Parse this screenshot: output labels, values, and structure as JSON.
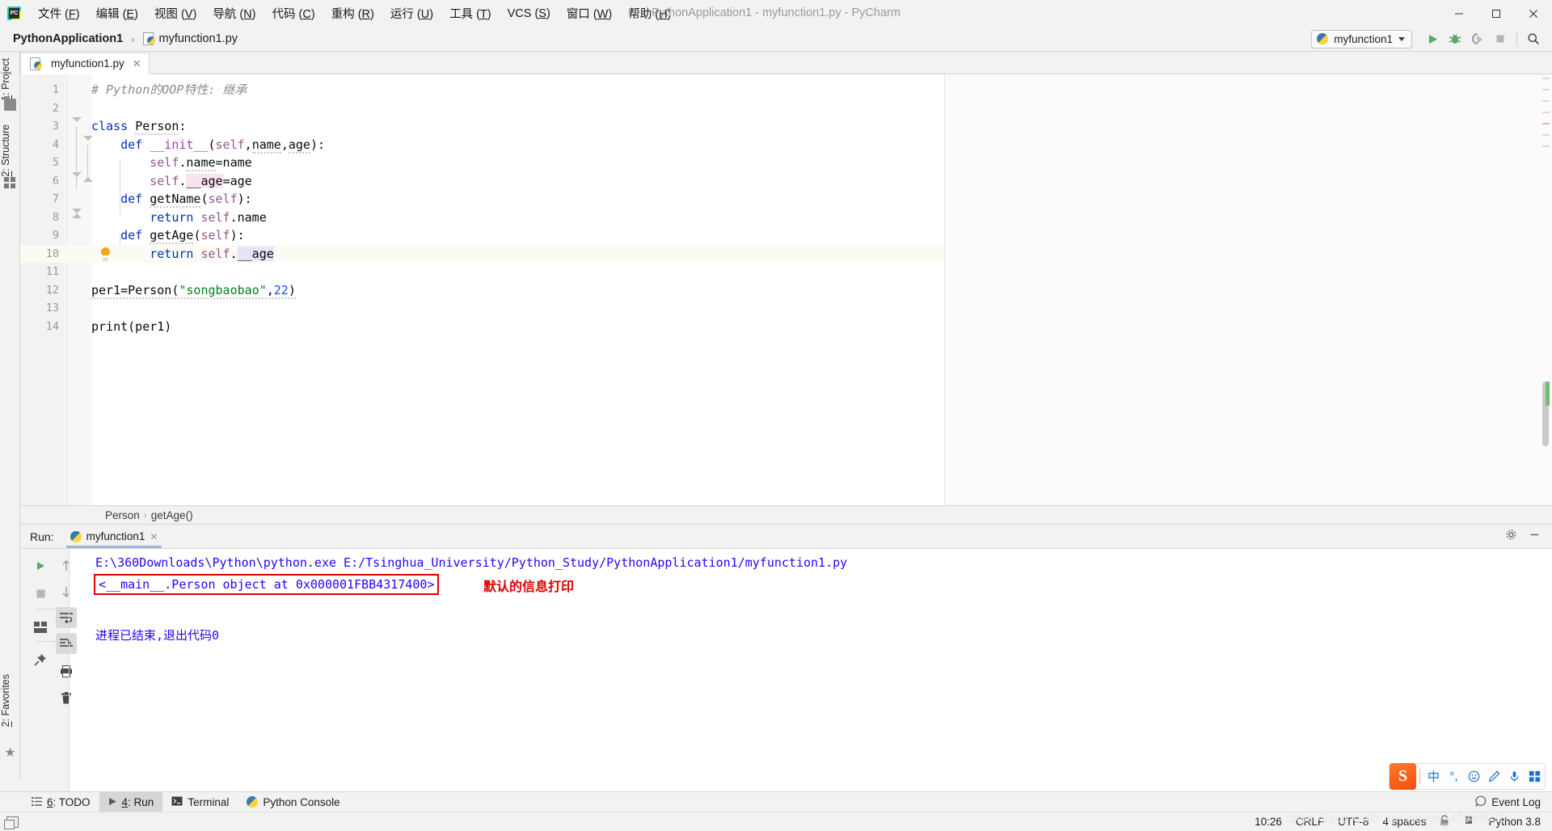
{
  "window": {
    "title": "PythonApplication1 - myfunction1.py - PyCharm",
    "minimize": "–",
    "maximize": "❐",
    "close": "✕"
  },
  "menubar": {
    "items": [
      {
        "label": "文件 (",
        "key": "F",
        "tail": ")"
      },
      {
        "label": "编辑 (",
        "key": "E",
        "tail": ")"
      },
      {
        "label": "视图 (",
        "key": "V",
        "tail": ")"
      },
      {
        "label": "导航 (",
        "key": "N",
        "tail": ")"
      },
      {
        "label": "代码 (",
        "key": "C",
        "tail": ")"
      },
      {
        "label": "重构 (",
        "key": "R",
        "tail": ")"
      },
      {
        "label": "运行 (",
        "key": "U",
        "tail": ")"
      },
      {
        "label": "工具 (",
        "key": "T",
        "tail": ")"
      },
      {
        "label": "VCS (",
        "key": "S",
        "tail": ")"
      },
      {
        "label": "窗口 (",
        "key": "W",
        "tail": ")"
      },
      {
        "label": "帮助 (",
        "key": "H",
        "tail": ")"
      }
    ]
  },
  "navbar": {
    "project": "PythonApplication1",
    "separator": "›",
    "file": "myfunction1.py",
    "run_config": "myfunction1",
    "buttons": [
      "run-button",
      "debug-button",
      "coverage-button",
      "stop-button",
      "search-everywhere-button"
    ]
  },
  "left_tool_strip": {
    "top_tabs": [
      {
        "digit": "1",
        "label": ": Project",
        "icon": "folder-icon"
      },
      {
        "digit": "2",
        "label": ": Structure",
        "icon": "structure-icon"
      }
    ],
    "bottom_tabs": [
      {
        "digit": "2",
        "label": ": Favorites",
        "icon": "star-icon"
      }
    ]
  },
  "editor": {
    "tab": {
      "label": "myfunction1.py",
      "close": "✕"
    },
    "lines": [
      {
        "n": "1",
        "html": "<span class='cmt'># Python的OOP特性: 继承</span>"
      },
      {
        "n": "2",
        "html": ""
      },
      {
        "n": "3",
        "html": "<span class='kw'>class</span> <span class='squig'>Person</span>:"
      },
      {
        "n": "4",
        "html": "    <span class='kw'>def</span> <span class='mag'>__init__</span>(<span class='self'>self</span>,<span class='squig'>name</span>,<span class='squig'>age</span>):"
      },
      {
        "n": "5",
        "html": "        <span class='self'>self</span>.<span class='squig'>name</span>=name"
      },
      {
        "n": "6",
        "html": "        <span class='self'>self</span>.<span class='hl-pink'>__age</span>=age"
      },
      {
        "n": "7",
        "html": "    <span class='kw'>def</span> <span class='squig'>getName</span>(<span class='self'>self</span>):"
      },
      {
        "n": "8",
        "html": "        <span class='kw'>return</span> <span class='self'>self</span>.name"
      },
      {
        "n": "9",
        "html": "    <span class='kw'>def</span> <span class='squig'>getAge</span>(<span class='self'>self</span>):"
      },
      {
        "n": "10",
        "html": "        <span class='kw'>return</span> <span class='self'>self</span>.<span class='hl-blue'>__age</span>",
        "highlight": true,
        "bulb": true
      },
      {
        "n": "11",
        "html": ""
      },
      {
        "n": "12",
        "html": "<span class='squig'>per1=Person(<span class='str'>\"songbaobao\"</span>,<span class='num'>22</span>)</span>"
      },
      {
        "n": "13",
        "html": ""
      },
      {
        "n": "14",
        "html": "print(per1)"
      }
    ],
    "breadcrumbs": {
      "class": "Person",
      "sep": "›",
      "method": "getAge()"
    }
  },
  "run_panel": {
    "label": "Run:",
    "tab": {
      "label": "myfunction1",
      "close": "✕"
    },
    "header_buttons": [
      "settings-gear-icon",
      "minimize-icon"
    ],
    "toolbar_buttons": [
      "rerun-button",
      "stop-button",
      "layout-button",
      "pin-tab-button",
      "up-stack-trace-button",
      "down-stack-trace-button",
      "soft-wrap-button",
      "scroll-to-end-button",
      "print-button",
      "clear-all-button"
    ],
    "console": {
      "command_line": "E:\\360Downloads\\Python\\python.exe E:/Tsinghua_University/Python_Study/PythonApplication1/myfunction1.py",
      "boxed_output": "<__main__.Person object at 0x000001FBB4317400>",
      "annotation": "默认的信息打印",
      "exit_line": "进程已结束,退出代码0",
      "box_color": "#e00000",
      "text_color": "#2a00ff"
    }
  },
  "ime_bar": {
    "logo": "S",
    "icons": [
      "chinese-mode-icon",
      "punctuation-icon",
      "emoji-icon",
      "pen-icon",
      "microphone-icon",
      "toolbox-icon"
    ],
    "chinese_glyph": "中",
    "punct_glyph": "°,",
    "emoji_glyph": "☺",
    "pen_glyph": "✎",
    "mic_glyph": "ᴮ",
    "grid_glyph": "⬚"
  },
  "bottom_bar": {
    "items": [
      {
        "digit": "6",
        "label": ": TODO",
        "icon": "list-icon",
        "active": false
      },
      {
        "digit": "4",
        "label": ": Run",
        "icon": "play-icon",
        "active": true
      },
      {
        "digit": "",
        "label": "Terminal",
        "icon": "terminal-icon",
        "active": false
      },
      {
        "digit": "",
        "label": "Python Console",
        "icon": "python-icon",
        "active": false
      }
    ],
    "event_log": "Event Log"
  },
  "status_bar": {
    "time": "10:26",
    "line_sep": "CRLF",
    "encoding": "UTF-8",
    "indent": "4 spaces",
    "lock_icon": "lock-icon",
    "inspection_icon": "inspection-icon",
    "interpreter": "Python 3.8",
    "watermark": "https://blog.csdn.net/weixin_43949535"
  }
}
